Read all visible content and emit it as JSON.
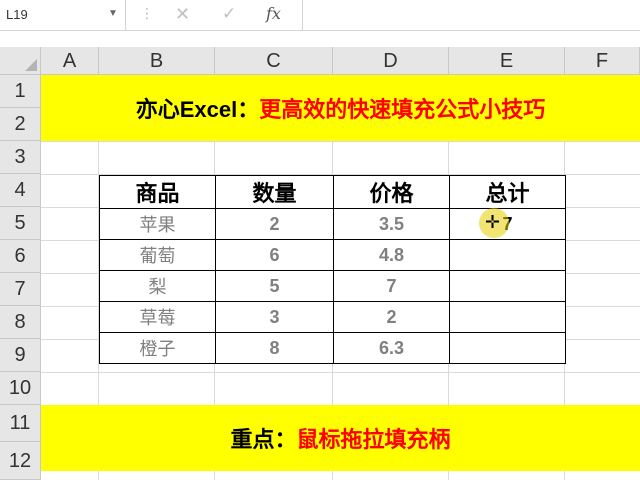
{
  "formula_bar": {
    "name_box": "L19",
    "dropdown_icon": "chevron-down-icon",
    "more_icon": "vertical-dots-icon",
    "cancel_icon": "cross-icon",
    "enter_icon": "checkmark-icon",
    "function_icon": "fx-icon",
    "formula": ""
  },
  "columns": [
    "A",
    "B",
    "C",
    "D",
    "E",
    "F"
  ],
  "rows": [
    "1",
    "2",
    "3",
    "4",
    "5",
    "6",
    "7",
    "8",
    "9",
    "10",
    "11",
    "12"
  ],
  "title": {
    "prefix": "亦心Excel：",
    "main": "更高效的快速填充公式小技巧"
  },
  "table": {
    "headers": [
      "商品",
      "数量",
      "价格",
      "总计"
    ],
    "rows": [
      {
        "item": "苹果",
        "qty": "2",
        "price": "3.5",
        "total": "7"
      },
      {
        "item": "葡萄",
        "qty": "6",
        "price": "4.8",
        "total": ""
      },
      {
        "item": "梨",
        "qty": "5",
        "price": "7",
        "total": ""
      },
      {
        "item": "草莓",
        "qty": "3",
        "price": "2",
        "total": ""
      },
      {
        "item": "橙子",
        "qty": "8",
        "price": "6.3",
        "total": ""
      }
    ]
  },
  "footer": {
    "prefix": "重点：",
    "main": "鼠标拖拉填充柄"
  },
  "colors": {
    "banner": "#ffff00",
    "accent_red": "#ff0000",
    "header_bg": "#e6e6e6"
  }
}
